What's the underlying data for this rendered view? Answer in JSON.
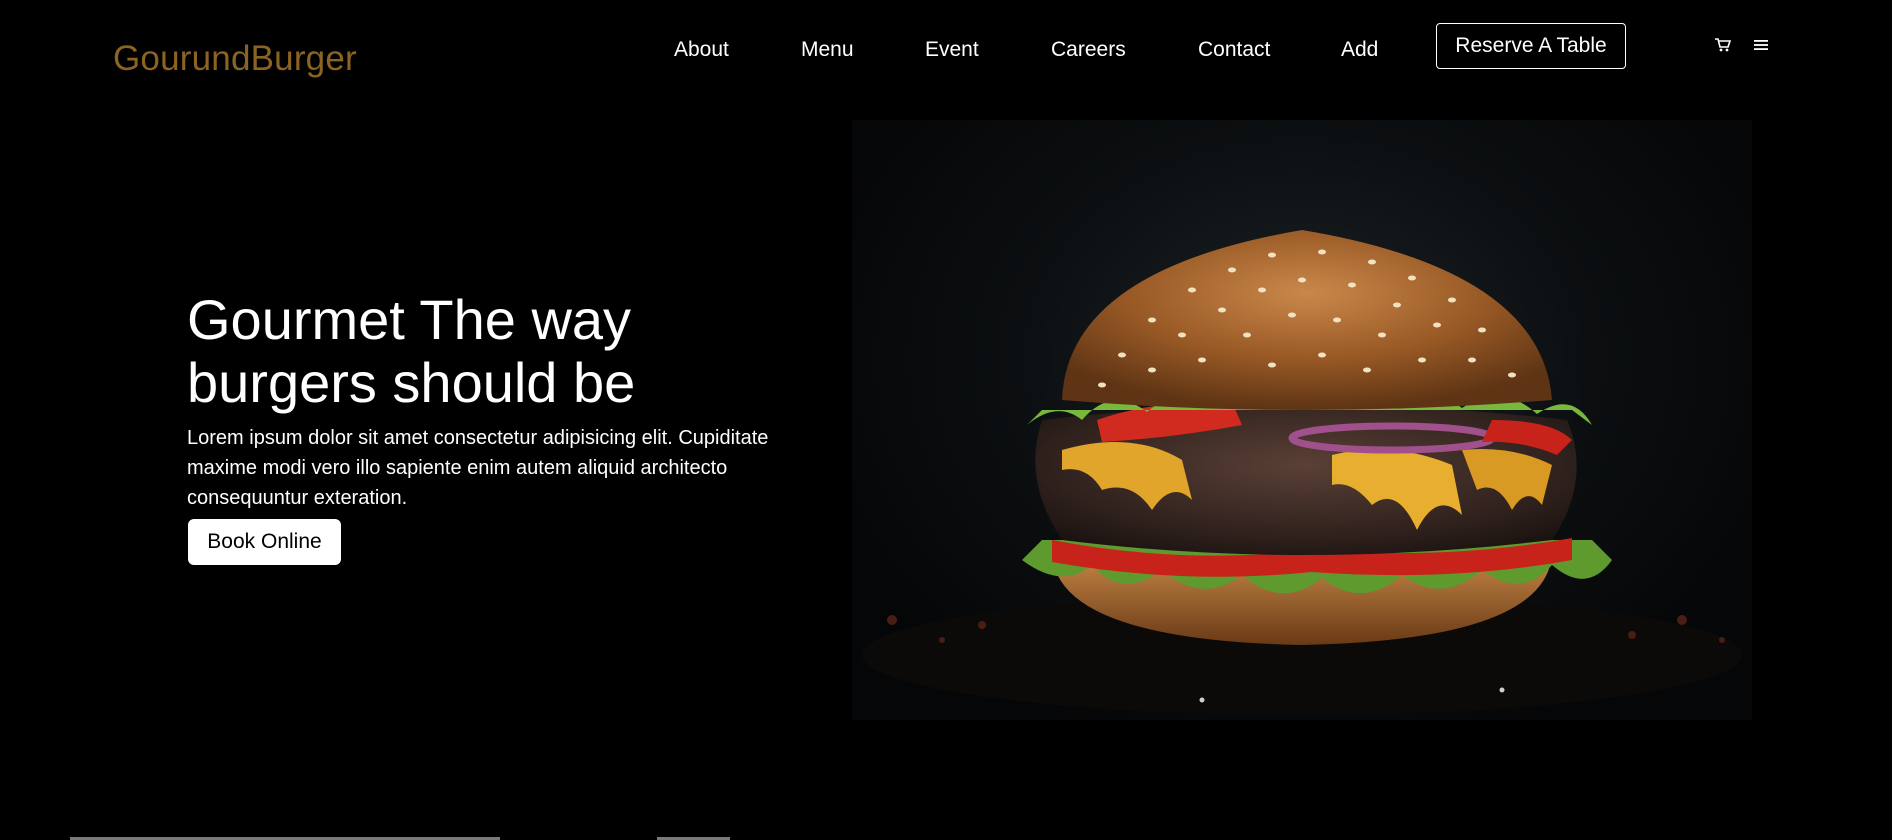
{
  "header": {
    "logo": "GourundBurger",
    "nav": [
      "About",
      "Menu",
      "Event",
      "Careers",
      "Contact",
      "Add"
    ],
    "reserve_label": "Reserve A Table",
    "cart_icon": "cart-icon",
    "menu_icon": "hamburger-menu-icon"
  },
  "hero": {
    "title": "Gourmet The way burgers should be",
    "text": "Lorem ipsum dolor sit amet consectetur adipisicing elit. Cupiditate maxime modi vero illo sapiente enim autem aliquid architecto consequuntur exteration.",
    "button_label": "Book Online",
    "image_subject": "burger-photo"
  },
  "colors": {
    "background": "#000000",
    "logo": "#8a6420",
    "text": "#ffffff"
  }
}
